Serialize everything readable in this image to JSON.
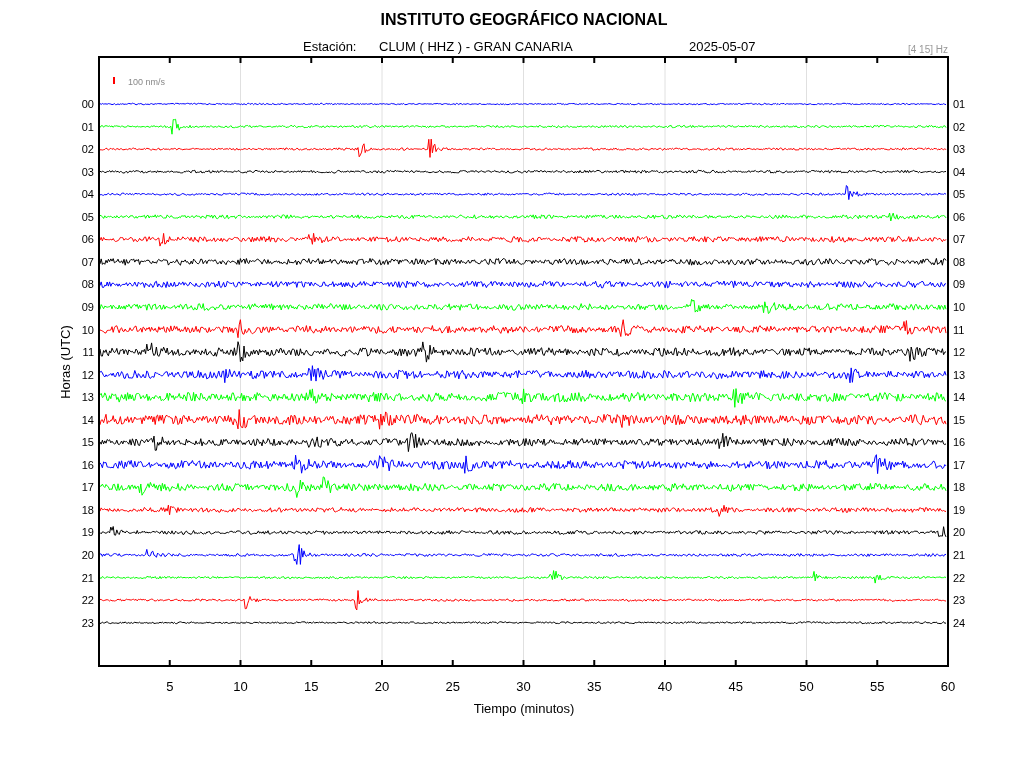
{
  "title": "INSTITUTO GEOGRÁFICO NACIONAL",
  "station_label": "Estación:",
  "station": "CLUM ( HHZ ) - GRAN CANARIA",
  "date": "2025-05-07",
  "filter": "[4 15] Hz",
  "scale_label": "100 nm/s",
  "y_axis_label": "Horas (UTC)",
  "x_axis": {
    "label": "Tiempo (minutos)",
    "ticks": [
      "5",
      "10",
      "15",
      "20",
      "25",
      "30",
      "35",
      "40",
      "45",
      "50",
      "55",
      "60"
    ]
  },
  "traces": [
    {
      "left_label": "00",
      "right_label": "01",
      "color": "#0000ff"
    },
    {
      "left_label": "01",
      "right_label": "02",
      "color": "#00ff00"
    },
    {
      "left_label": "02",
      "right_label": "03",
      "color": "#ff0000"
    },
    {
      "left_label": "03",
      "right_label": "04",
      "color": "#000000"
    },
    {
      "left_label": "04",
      "right_label": "05",
      "color": "#0000ff"
    },
    {
      "left_label": "05",
      "right_label": "06",
      "color": "#00ff00"
    },
    {
      "left_label": "06",
      "right_label": "07",
      "color": "#ff0000"
    },
    {
      "left_label": "07",
      "right_label": "08",
      "color": "#000000"
    },
    {
      "left_label": "08",
      "right_label": "09",
      "color": "#0000ff"
    },
    {
      "left_label": "09",
      "right_label": "10",
      "color": "#00ff00"
    },
    {
      "left_label": "10",
      "right_label": "11",
      "color": "#ff0000"
    },
    {
      "left_label": "11",
      "right_label": "12",
      "color": "#000000"
    },
    {
      "left_label": "12",
      "right_label": "13",
      "color": "#0000ff"
    },
    {
      "left_label": "13",
      "right_label": "14",
      "color": "#00ff00"
    },
    {
      "left_label": "14",
      "right_label": "15",
      "color": "#ff0000"
    },
    {
      "left_label": "15",
      "right_label": "16",
      "color": "#000000"
    },
    {
      "left_label": "16",
      "right_label": "17",
      "color": "#0000ff"
    },
    {
      "left_label": "17",
      "right_label": "18",
      "color": "#00ff00"
    },
    {
      "left_label": "18",
      "right_label": "19",
      "color": "#ff0000"
    },
    {
      "left_label": "19",
      "right_label": "20",
      "color": "#000000"
    },
    {
      "left_label": "20",
      "right_label": "21",
      "color": "#0000ff"
    },
    {
      "left_label": "21",
      "right_label": "22",
      "color": "#00ff00"
    },
    {
      "left_label": "22",
      "right_label": "23",
      "color": "#ff0000"
    },
    {
      "left_label": "23",
      "right_label": "24",
      "color": "#000000"
    }
  ]
}
